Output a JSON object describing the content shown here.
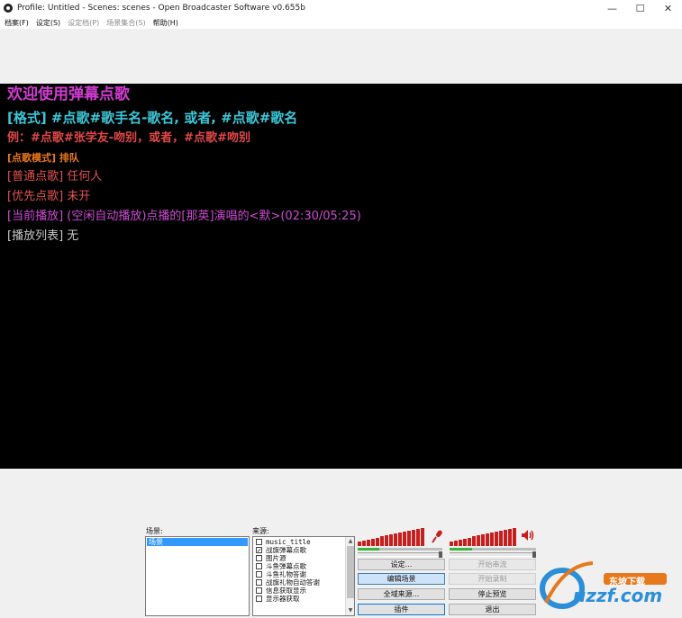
{
  "window": {
    "title": "Profile: Untitled - Scenes: scenes - Open Broadcaster Software v0.655b",
    "controls": {
      "minimize": "—",
      "maximize": "☐",
      "close": "✕"
    }
  },
  "menu": {
    "items": [
      {
        "label": "档案(F)",
        "enabled": true
      },
      {
        "label": "设定(S)",
        "enabled": true
      },
      {
        "label": "设定档(P)",
        "enabled": false
      },
      {
        "label": "场景集合(S)",
        "enabled": false
      },
      {
        "label": "帮助(H)",
        "enabled": true
      }
    ]
  },
  "preview": {
    "lines": [
      "欢迎使用弹幕点歌",
      "[格式] #点歌#歌手名-歌名, 或者, #点歌#歌名",
      "例：#点歌#张学友-吻别，或者，#点歌#吻别",
      "[点歌模式] 排队",
      "[普通点歌] 任何人",
      "[优先点歌] 未开",
      "[当前播放] (空闲自动播放)点播的[那英]演唱的<默>(02:30/05:25)",
      "[播放列表] 无"
    ]
  },
  "scenes": {
    "label": "场景:",
    "items": [
      "场景"
    ]
  },
  "sources": {
    "label": "来源:",
    "items": [
      {
        "label": "music_title",
        "checked": false
      },
      {
        "label": "战旗弹幕点歌",
        "checked": true
      },
      {
        "label": "图片源",
        "checked": false
      },
      {
        "label": "斗鱼弹幕点歌",
        "checked": false
      },
      {
        "label": "斗鱼礼物答谢",
        "checked": false
      },
      {
        "label": "战旗礼物自动答谢",
        "checked": false
      },
      {
        "label": "信息获取显示",
        "checked": false
      },
      {
        "label": "显示器获取",
        "checked": false
      }
    ]
  },
  "audio": {
    "mic_level": 0.62,
    "desktop_level": 0.62,
    "mic_volume": 1.0,
    "desktop_volume": 1.0
  },
  "buttons": {
    "settings": "设定...",
    "start_stream": "开始串流",
    "edit_scene": "编辑场景",
    "start_record": "开始录制",
    "global_sources": "全域来源...",
    "stop_preview": "停止预览",
    "plugins": "插件",
    "exit": "退出"
  },
  "watermark": {
    "brand": "uzzf.com",
    "tagline": "东坡下载"
  },
  "colors": {
    "preview_bg": "#000000",
    "selection": "#3399ff",
    "meter_red": "#c81e1e",
    "meter_green": "#3cb43c"
  }
}
